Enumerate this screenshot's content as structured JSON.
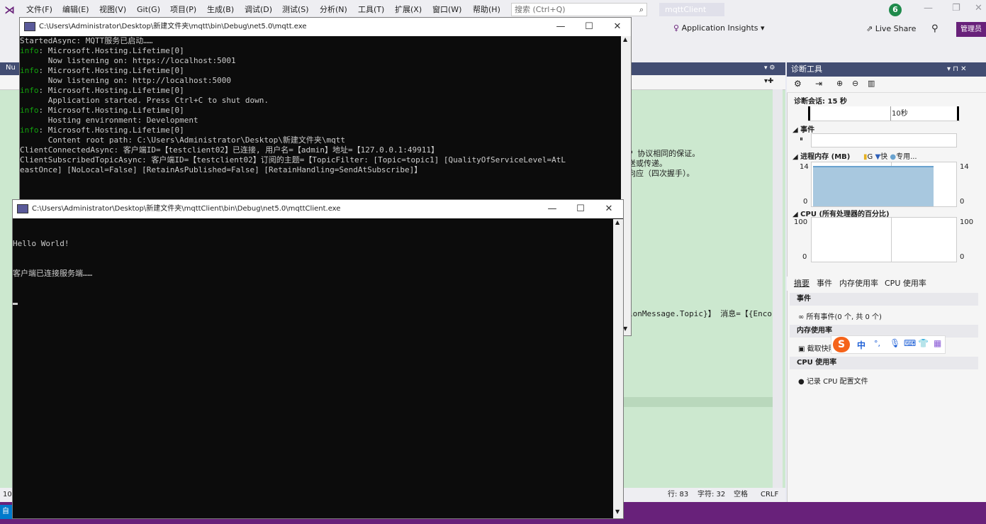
{
  "vs": {
    "menu": [
      "文件(F)",
      "编辑(E)",
      "视图(V)",
      "Git(G)",
      "项目(P)",
      "生成(B)",
      "调试(D)",
      "测试(S)",
      "分析(N)",
      "工具(T)",
      "扩展(X)",
      "窗口(W)",
      "帮助(H)"
    ],
    "search_placeholder": "搜索 (Ctrl+Q)",
    "solution_name": "mqttClient",
    "notification_count": "6",
    "toolbar": {
      "app_insights": "Application Insights",
      "live_share": "Live Share",
      "admin": "管理员"
    },
    "editor": {
      "line1": "P 协议相同的保证。",
      "line2": "送或传递。",
      "line3": "向应（四次握手）。",
      "code_line": "ionMessage.Topic}】 消息=【{Enco"
    },
    "statusbar": {
      "row": "行: 83",
      "col": "字符: 32",
      "spaces": "空格",
      "eol": "CRLF"
    },
    "left_labels": {
      "nu": "Nu",
      "bottom_num": "10",
      "bottom_char": "自"
    }
  },
  "diag": {
    "title": "诊断工具",
    "session": "诊断会话: 15 秒",
    "timeline_label": "10秒",
    "events_header": "事件",
    "memory_header": "进程内存 (MB)",
    "memory_legend": [
      "G",
      "快",
      "专用..."
    ],
    "memory_max": "14",
    "memory_min": "0",
    "cpu_header": "CPU (所有处理器的百分比)",
    "cpu_max": "100",
    "cpu_min": "0",
    "tabs": [
      "摘要",
      "事件",
      "内存使用率",
      "CPU 使用率"
    ],
    "events_section": "事件",
    "all_events": "所有事件(0 个, 共 0 个)",
    "memory_section": "内存使用率",
    "snapshot": "截取快照",
    "cpu_section": "CPU 使用率",
    "record_cpu": "记录 CPU 配置文件",
    "memory_level_fraction": 0.88
  },
  "ime": {
    "lang": "中",
    "items": [
      "°,",
      "mic",
      "kbd",
      "shirt",
      "grid"
    ]
  },
  "server": {
    "title": "C:\\Users\\Administrator\\Desktop\\新建文件夹\\mqtt\\bin\\Debug\\net5.0\\mqtt.exe",
    "lines": [
      {
        "prefix": "",
        "text": "StartedAsync: MQTT服务已启动……"
      },
      {
        "prefix": "info",
        "text": ": Microsoft.Hosting.Lifetime[0]"
      },
      {
        "prefix": "",
        "text": "      Now listening on: https://localhost:5001"
      },
      {
        "prefix": "info",
        "text": ": Microsoft.Hosting.Lifetime[0]"
      },
      {
        "prefix": "",
        "text": "      Now listening on: http://localhost:5000"
      },
      {
        "prefix": "info",
        "text": ": Microsoft.Hosting.Lifetime[0]"
      },
      {
        "prefix": "",
        "text": "      Application started. Press Ctrl+C to shut down."
      },
      {
        "prefix": "info",
        "text": ": Microsoft.Hosting.Lifetime[0]"
      },
      {
        "prefix": "",
        "text": "      Hosting environment: Development"
      },
      {
        "prefix": "info",
        "text": ": Microsoft.Hosting.Lifetime[0]"
      },
      {
        "prefix": "",
        "text": "      Content root path: C:\\Users\\Administrator\\Desktop\\新建文件夹\\mqtt"
      },
      {
        "prefix": "",
        "text": "ClientConnectedAsync: 客户端ID=【testclient02】已连接, 用户名=【admin】地址=【127.0.0.1:49911】"
      },
      {
        "prefix": "",
        "text": "ClientSubscribedTopicAsync: 客户端ID=【testclient02】订阅的主题=【TopicFilter: [Topic=topic1] [QualityOfServiceLevel=AtL"
      },
      {
        "prefix": "",
        "text": "eastOnce] [NoLocal=False] [RetainAsPublished=False] [RetainHandling=SendAtSubscribe]】"
      }
    ]
  },
  "client": {
    "title": "C:\\Users\\Administrator\\Desktop\\新建文件夹\\mqttClient\\bin\\Debug\\net5.0\\mqttClient.exe",
    "lines": [
      "Hello World!",
      "客户端已连接服务端……"
    ]
  }
}
